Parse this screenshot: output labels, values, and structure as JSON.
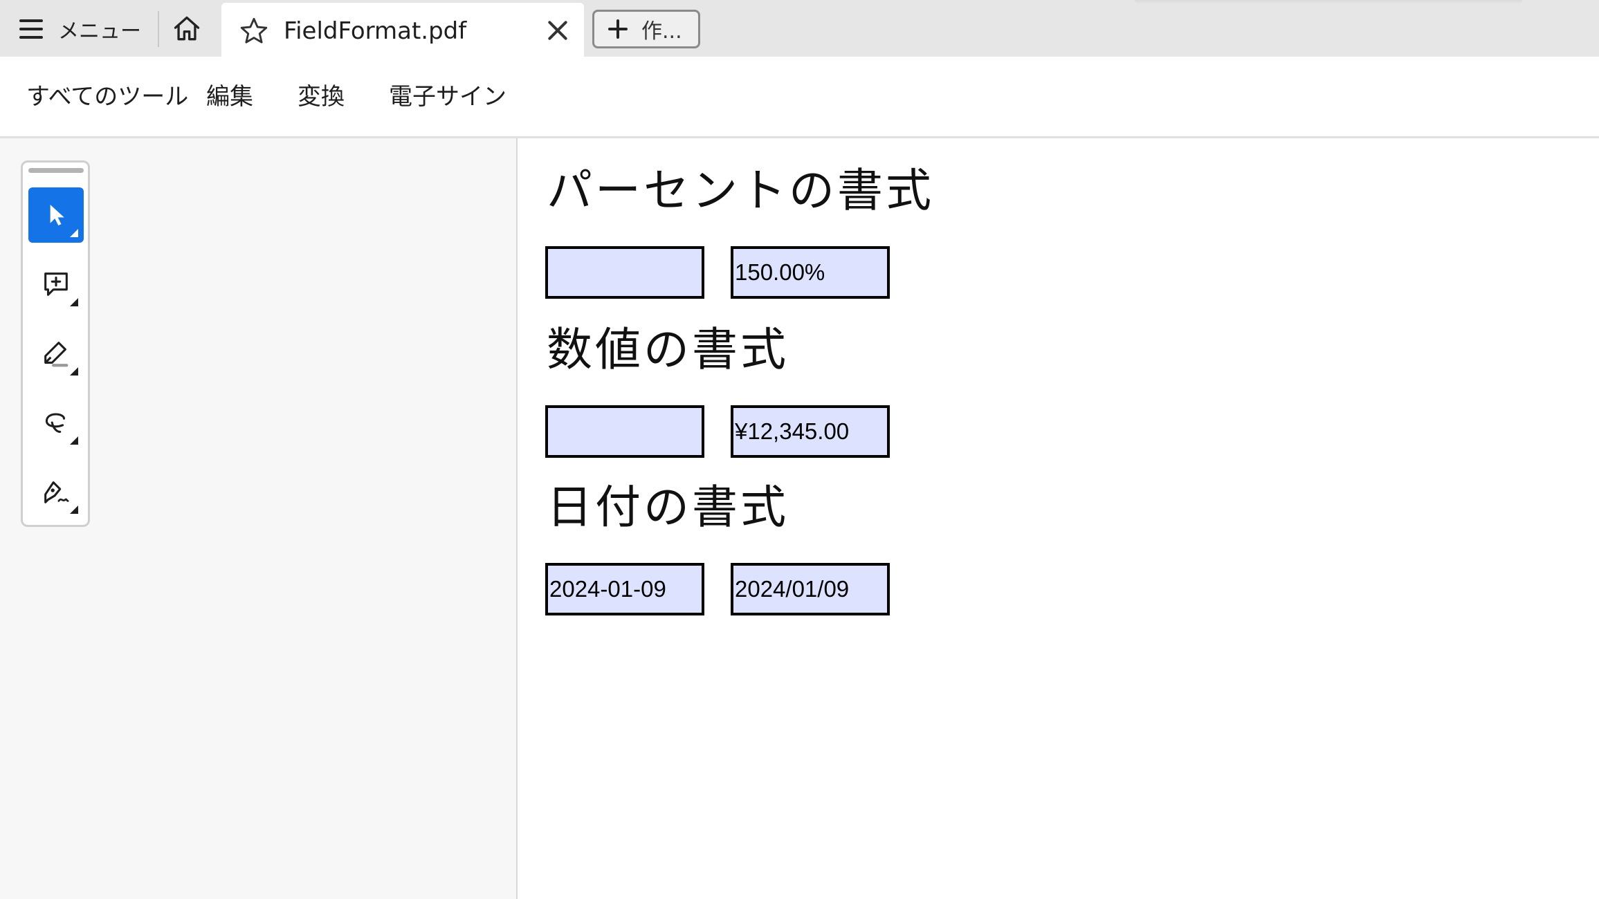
{
  "tabbar": {
    "menu_label": "メニュー",
    "doc_tab_title": "FieldFormat.pdf",
    "new_tab_label": "作..."
  },
  "toolsbar": {
    "items": [
      "すべてのツール",
      "編集",
      "変換",
      "電子サイン"
    ]
  },
  "quick_tools": [
    {
      "icon": "select-arrow-icon",
      "active": true
    },
    {
      "icon": "add-comment-icon",
      "active": false
    },
    {
      "icon": "highlight-pen-icon",
      "active": false
    },
    {
      "icon": "draw-freehand-icon",
      "active": false
    },
    {
      "icon": "sign-pen-icon",
      "active": false
    }
  ],
  "document": {
    "sections": [
      {
        "heading": "パーセントの書式",
        "fields": [
          "",
          "150.00%"
        ]
      },
      {
        "heading": "数値の書式",
        "fields": [
          "",
          "¥12,345.00"
        ]
      },
      {
        "heading": "日付の書式",
        "fields": [
          "2024-01-09",
          "2024/01/09"
        ]
      }
    ]
  },
  "colors": {
    "accent": "#1473e6",
    "field_fill": "#dde3ff",
    "tabbar_bg": "#e6e6e6",
    "panel_bg": "#f7f7f7"
  }
}
